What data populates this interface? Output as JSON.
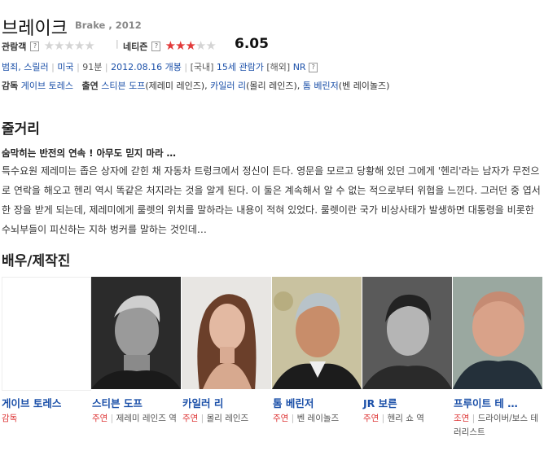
{
  "movie": {
    "title_ko": "브레이크",
    "title_en": "Brake , 2012"
  },
  "ratings": {
    "audience_label": "관람객",
    "netizen_label": "네티즌",
    "help_glyph": "?",
    "audience_stars": 0,
    "netizen_stars": 3,
    "netizen_score": "6.05",
    "star_color": "#e23a3a"
  },
  "info": {
    "genres": "범죄, 스릴러",
    "country": "미국",
    "runtime": "91분",
    "release": "2012.08.16 개봉",
    "rating_kr_label": "[국내]",
    "rating_kr": "15세 관람가",
    "rating_int_label": "[해외]",
    "rating_int": "NR"
  },
  "credits": {
    "director_label": "감독",
    "director": "게이브 토레스",
    "cast_label": "출연",
    "cast": [
      {
        "name": "스티븐 도프",
        "role": "(제레미 레인즈),"
      },
      {
        "name": "카일러 리",
        "role": "(몰리 레인즈),"
      },
      {
        "name": "톰 베린저",
        "role": "(벤 레이놀즈)"
      }
    ]
  },
  "synopsis": {
    "heading": "줄거리",
    "tagline": "숨막히는 반전의 연속 ! 아무도 믿지 마라 …",
    "body": "특수요원 제레미는 좁은 상자에 갇힌 채 자동차 트렁크에서 정신이 든다. 영문을 모르고 당황해 있던 그에게 '헨리'라는 남자가 무전으로 연락을 해오고 헨리 역시 똑같은 처지라는 것을 알게 된다. 이 둘은 계속해서 알 수 없는 적으로부터 위협을 느낀다. 그러던 중 엽서 한 장을 받게 되는데, 제레미에게 룰렛의 위치를 말하라는 내용이 적혀 있었다. 룰렛이란 국가 비상사태가 발생하면 대통령을 비롯한 수뇌부들이 피신하는 지하 벙커를 말하는 것인데…"
  },
  "cast_section": {
    "heading": "배우/제작진",
    "people": [
      {
        "name": "게이브 토레스",
        "part": "감독",
        "character": ""
      },
      {
        "name": "스티븐 도프",
        "part": "주연",
        "character": "제레미 레인즈 역"
      },
      {
        "name": "카일러 리",
        "part": "주연",
        "character": "몰리 레인즈"
      },
      {
        "name": "톰 베린저",
        "part": "주연",
        "character": "벤 레이놀즈"
      },
      {
        "name": "JR 보른",
        "part": "주연",
        "character": "헨리 쇼 역"
      },
      {
        "name": "프루이트 테 …",
        "part": "조연",
        "character": "드라이버/보스 테러리스트"
      }
    ]
  }
}
